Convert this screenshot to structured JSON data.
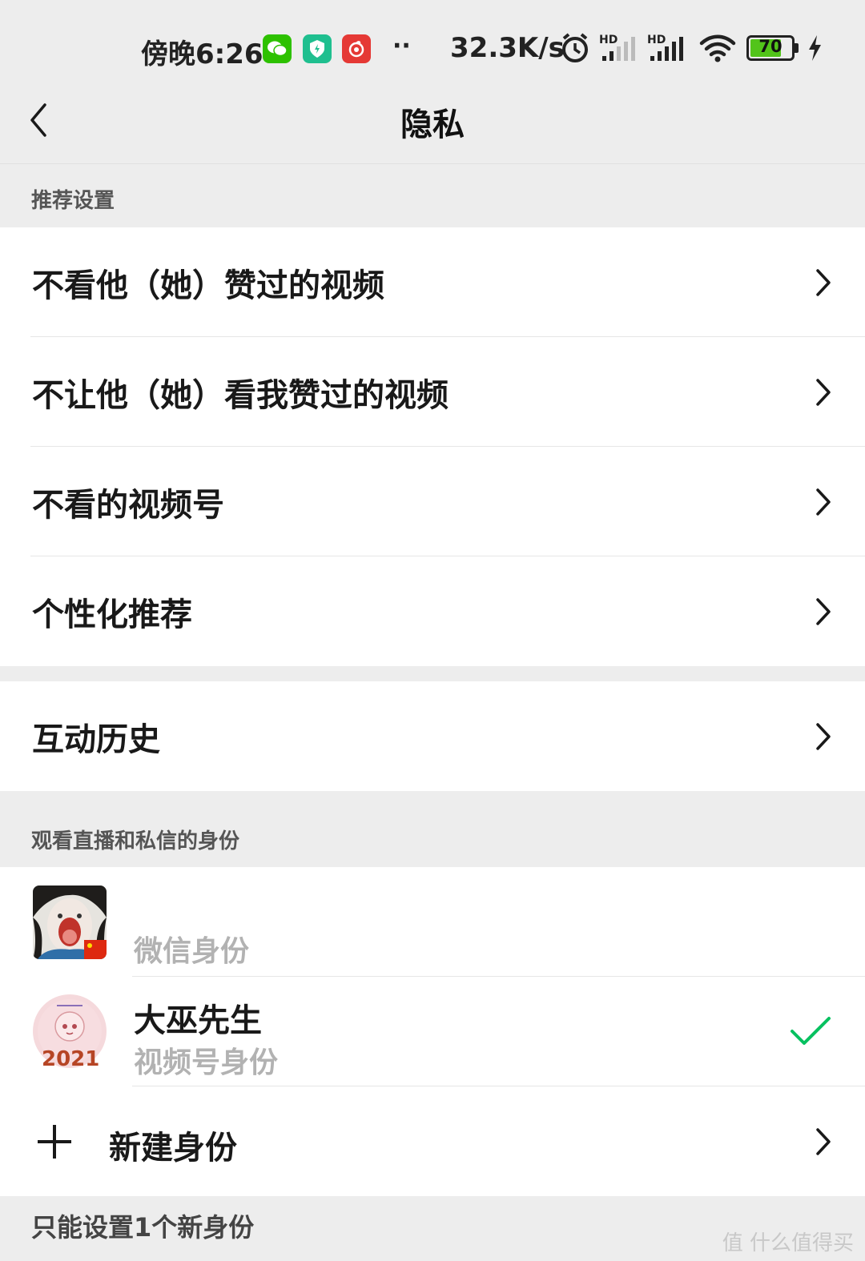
{
  "status_bar": {
    "time": "傍晚6:26",
    "dots": "··",
    "speed": "32.3K/s",
    "battery": "70",
    "icons": [
      "wechat-icon",
      "shield-icon",
      "netease-music-icon",
      "alarm-icon",
      "signal-hd-icon",
      "signal-hd-icon",
      "wifi-icon",
      "battery-icon",
      "charging-icon"
    ],
    "colors": {
      "wechat": "#2dc100",
      "shield": "#1fbf8f",
      "netease": "#e53935",
      "battery_fill": "#52c41a"
    }
  },
  "nav": {
    "title": "隐私"
  },
  "recommend_section": {
    "header": "推荐设置",
    "items": [
      {
        "label": "不看他（她）赞过的视频"
      },
      {
        "label": "不让他（她）看我赞过的视频"
      },
      {
        "label": "不看的视频号"
      },
      {
        "label": "个性化推荐"
      }
    ]
  },
  "history_section": {
    "items": [
      {
        "label": "互动历史"
      }
    ]
  },
  "identity_section": {
    "header": "观看直播和私信的身份",
    "identities": [
      {
        "name": "",
        "subtitle": "微信身份",
        "selected": false
      },
      {
        "name": "大巫先生",
        "subtitle": "视频号身份",
        "selected": true,
        "avatar_text": "2021"
      }
    ],
    "new_identity": {
      "label": "新建身份"
    },
    "footer": "只能设置1个新身份"
  },
  "watermark": "值 什么值得买",
  "accent_color": "#07c160"
}
